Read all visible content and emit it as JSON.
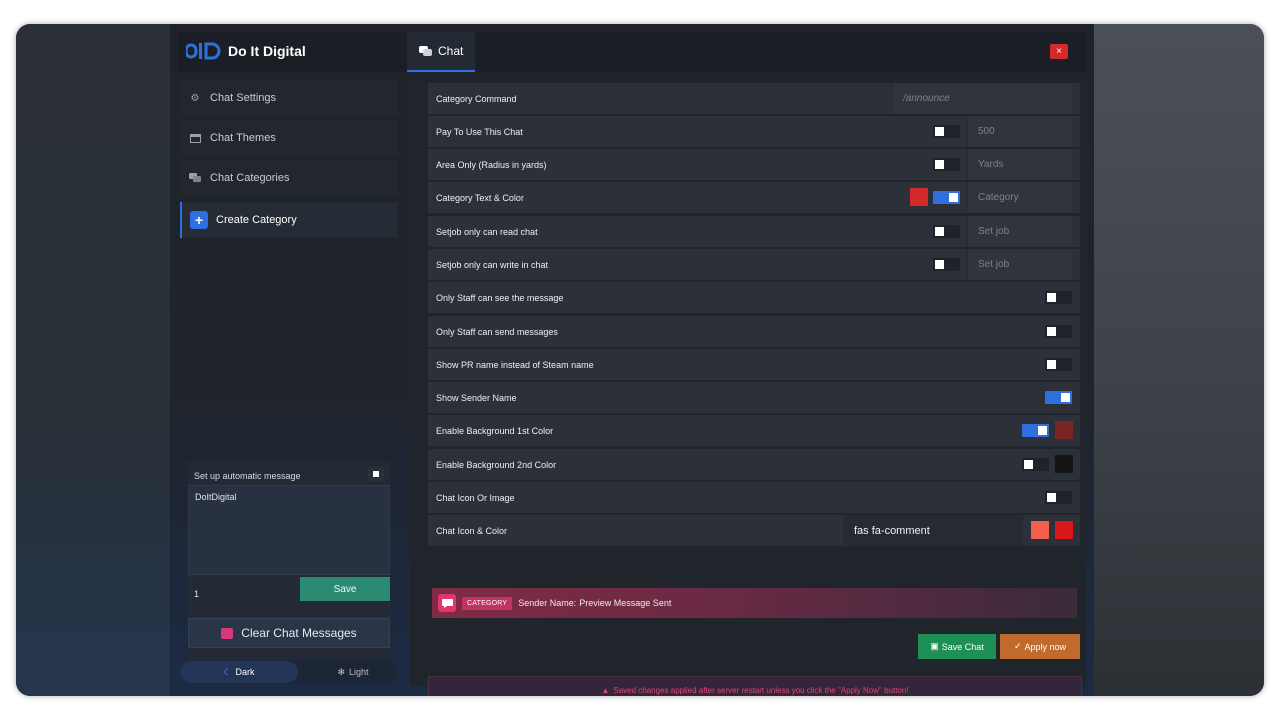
{
  "app": {
    "title": "Do It Digital",
    "tab": "Chat",
    "close": "×"
  },
  "sidebar": {
    "items": [
      {
        "label": "Chat Settings",
        "icon": "cogs-icon"
      },
      {
        "label": "Chat Themes",
        "icon": "window-icon"
      },
      {
        "label": "Chat Categories",
        "icon": "comments-icon"
      },
      {
        "label": "Create Category",
        "icon": "plus-icon"
      }
    ]
  },
  "auto_message": {
    "label": "Set up automatic message",
    "text": "DoItDigital",
    "interval": "1",
    "save": "Save"
  },
  "clear": {
    "label": "Clear Chat Messages"
  },
  "theme": {
    "dark": "Dark",
    "light": "Light"
  },
  "form": {
    "rows": [
      {
        "label": "Category Command",
        "placeholder": "/announce"
      },
      {
        "label": "Pay To Use This Chat",
        "toggle": false,
        "value": "500"
      },
      {
        "label": "Area Only (Radius in yards)",
        "toggle": false,
        "placeholder": "Yards"
      },
      {
        "label": "Category Text & Color",
        "color": "#d22a2a",
        "toggle": true,
        "placeholder": "Category"
      },
      {
        "label": "Setjob only can read chat",
        "toggle": false,
        "placeholder": "Set job"
      },
      {
        "label": "Setjob only can write in chat",
        "toggle": false,
        "placeholder": "Set job"
      },
      {
        "label": "Only Staff can see the message",
        "toggle": false
      },
      {
        "label": "Only Staff can send messages",
        "toggle": false
      },
      {
        "label": "Show PR name instead of Steam name",
        "toggle": false
      },
      {
        "label": "Show Sender Name",
        "toggle": true
      },
      {
        "label": "Enable Background 1st Color",
        "toggle": true,
        "color": "#7a2424"
      },
      {
        "label": "Enable Background 2nd Color",
        "toggle": false,
        "color": "#141414"
      },
      {
        "label": "Chat Icon Or Image",
        "toggle": false
      },
      {
        "label": "Chat Icon & Color",
        "icon_value": "fas fa-comment",
        "color1": "#f0604a",
        "color2": "#d81818"
      }
    ]
  },
  "preview": {
    "category": "CATEGORY",
    "sender": "Sender Name:",
    "message": "Preview Message Sent"
  },
  "buttons": {
    "save_chat": "Save Chat",
    "apply_now": "Apply now"
  },
  "notice": "Saved changes applied after server restart unless you click the \"Apply Now\" button!",
  "colors": {
    "accent": "#2f6fe0",
    "save_green": "#1e8f55",
    "apply_orange": "#c06a2e",
    "danger": "#d42a2a"
  }
}
